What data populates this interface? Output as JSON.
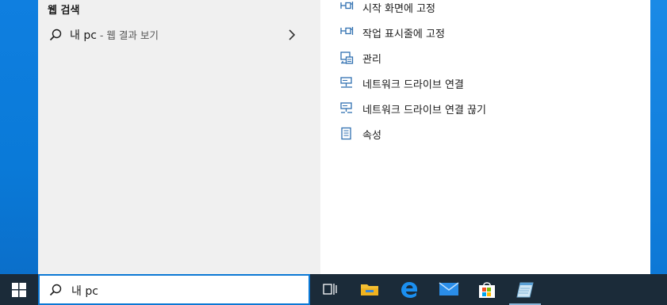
{
  "left_pane": {
    "section_title": "웹 검색",
    "web_result": {
      "query": "내 pc",
      "suffix": " - 웹 결과 보기",
      "icon": "search-icon",
      "arrow_icon": "chevron-right-icon"
    }
  },
  "right_pane": {
    "actions": [
      {
        "label": "시작 화면에 고정",
        "icon": "pin-icon"
      },
      {
        "label": "작업 표시줄에 고정",
        "icon": "pin-icon"
      },
      {
        "label": "관리",
        "icon": "computer-management-icon"
      },
      {
        "label": "네트워크 드라이브 연결",
        "icon": "network-drive-icon"
      },
      {
        "label": "네트워크 드라이브 연결 끊기",
        "icon": "network-drive-disconnect-icon"
      },
      {
        "label": "속성",
        "icon": "properties-icon"
      }
    ]
  },
  "taskbar": {
    "search_text": "내 pc",
    "items": [
      "windows-start-icon",
      "task-view-icon",
      "file-explorer-icon",
      "edge-icon",
      "mail-icon",
      "store-icon",
      "notepad-icon"
    ]
  },
  "colors": {
    "accent": "#0b78d4",
    "taskbar": "#1b2b39",
    "icon_blue": "#2f6fb0"
  }
}
